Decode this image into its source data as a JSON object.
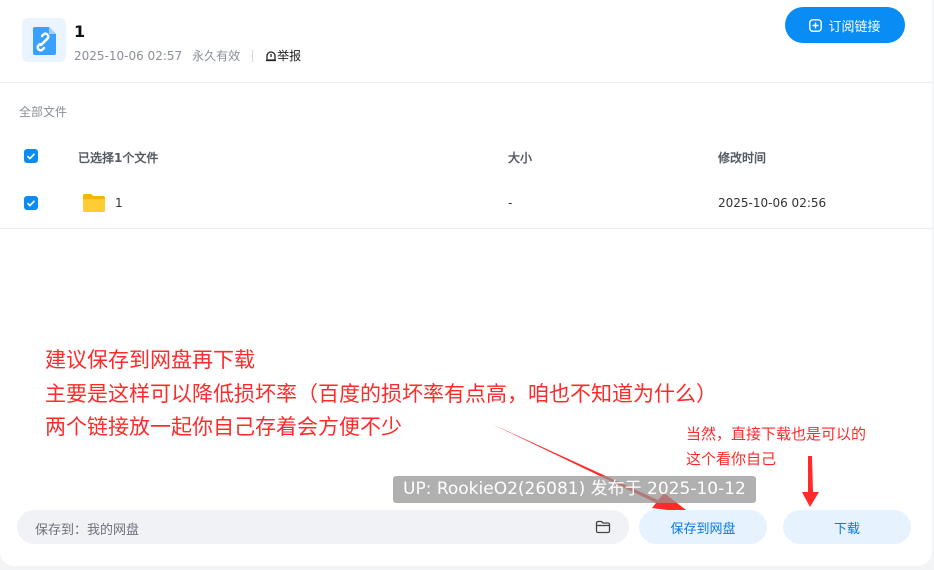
{
  "header": {
    "title": "1",
    "date": "2025-10-06 02:57",
    "validity": "永久有效",
    "report_label": "举报",
    "subscribe_label": "订阅链接"
  },
  "breadcrumb": "全部文件",
  "table": {
    "headers": {
      "name": "已选择1个文件",
      "size": "大小",
      "modified": "修改时间"
    },
    "rows": [
      {
        "name": "1",
        "size": "-",
        "modified": "2025-10-06 02:56",
        "checked": true
      }
    ]
  },
  "annotations": {
    "line1": "建议保存到网盘再下载",
    "line2": "主要是这样可以降低损坏率（百度的损坏率有点高，咱也不知道为什么）",
    "line3": "两个链接放一起你自己存着会方便不少",
    "side1": "当然，直接下载也是可以的",
    "side2": "这个看你自己"
  },
  "watermark": "UP: RookieO2(26081) 发布于 2025-10-12",
  "footer": {
    "save_path_label": "保存到：我的网盘",
    "save_button": "保存到网盘",
    "download_button": "下载"
  },
  "colors": {
    "accent": "#0a8cf5",
    "annotation": "#ff2a2a"
  }
}
